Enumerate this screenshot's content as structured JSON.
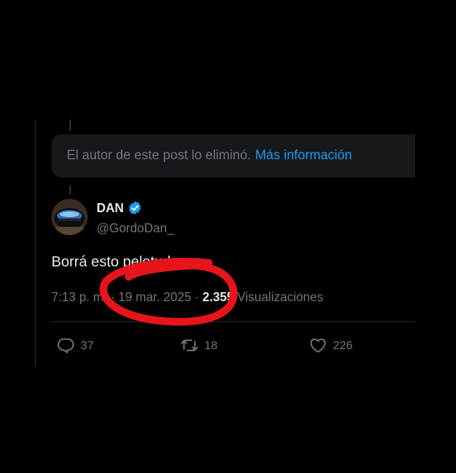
{
  "notice": {
    "text": "El autor de este post lo eliminó.",
    "link": "Más información"
  },
  "author": {
    "name": "DAN",
    "handle": "@GordoDan_"
  },
  "post": {
    "text": "Borrá esto pelotudo",
    "time": "7:13 p. m.",
    "separator": "·",
    "date": "19 mar. 2025",
    "views_count": "2.355",
    "views_label": "Visualizaciones"
  },
  "actions": {
    "replies": "37",
    "reposts": "18",
    "likes": "226"
  },
  "colors": {
    "background": "#000000",
    "accent": "#1d9bf0",
    "muted": "#71767b",
    "annotation": "#e8141c"
  },
  "icons": [
    "reply-icon",
    "repost-icon",
    "like-icon",
    "verified-badge-icon"
  ]
}
